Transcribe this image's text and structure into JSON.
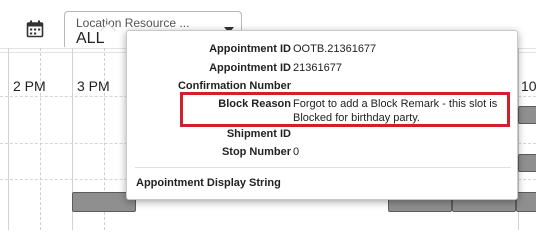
{
  "toolbar": {
    "calendar_icon": "calendar-icon",
    "location_filter": {
      "label": "Location Resource ...",
      "value": "ALL"
    }
  },
  "timeline": {
    "hours": [
      "2 PM",
      "3 PM",
      "10"
    ]
  },
  "popup": {
    "fields": [
      {
        "label": "Appointment ID",
        "value": "OOTB.21361677"
      },
      {
        "label": "Appointment ID",
        "value": "21361677"
      },
      {
        "label": "Confirmation Number",
        "value": ""
      },
      {
        "label": "Block Reason",
        "value": "Forgot to add a Block Remark - this slot is Blocked for birthday party."
      },
      {
        "label": "Shipment ID",
        "value": ""
      },
      {
        "label": "Stop Number",
        "value": "0"
      }
    ],
    "display_string_label": "Appointment Display String"
  },
  "colors": {
    "highlight": "#d21f2b",
    "slot": "#8f8f8f"
  }
}
